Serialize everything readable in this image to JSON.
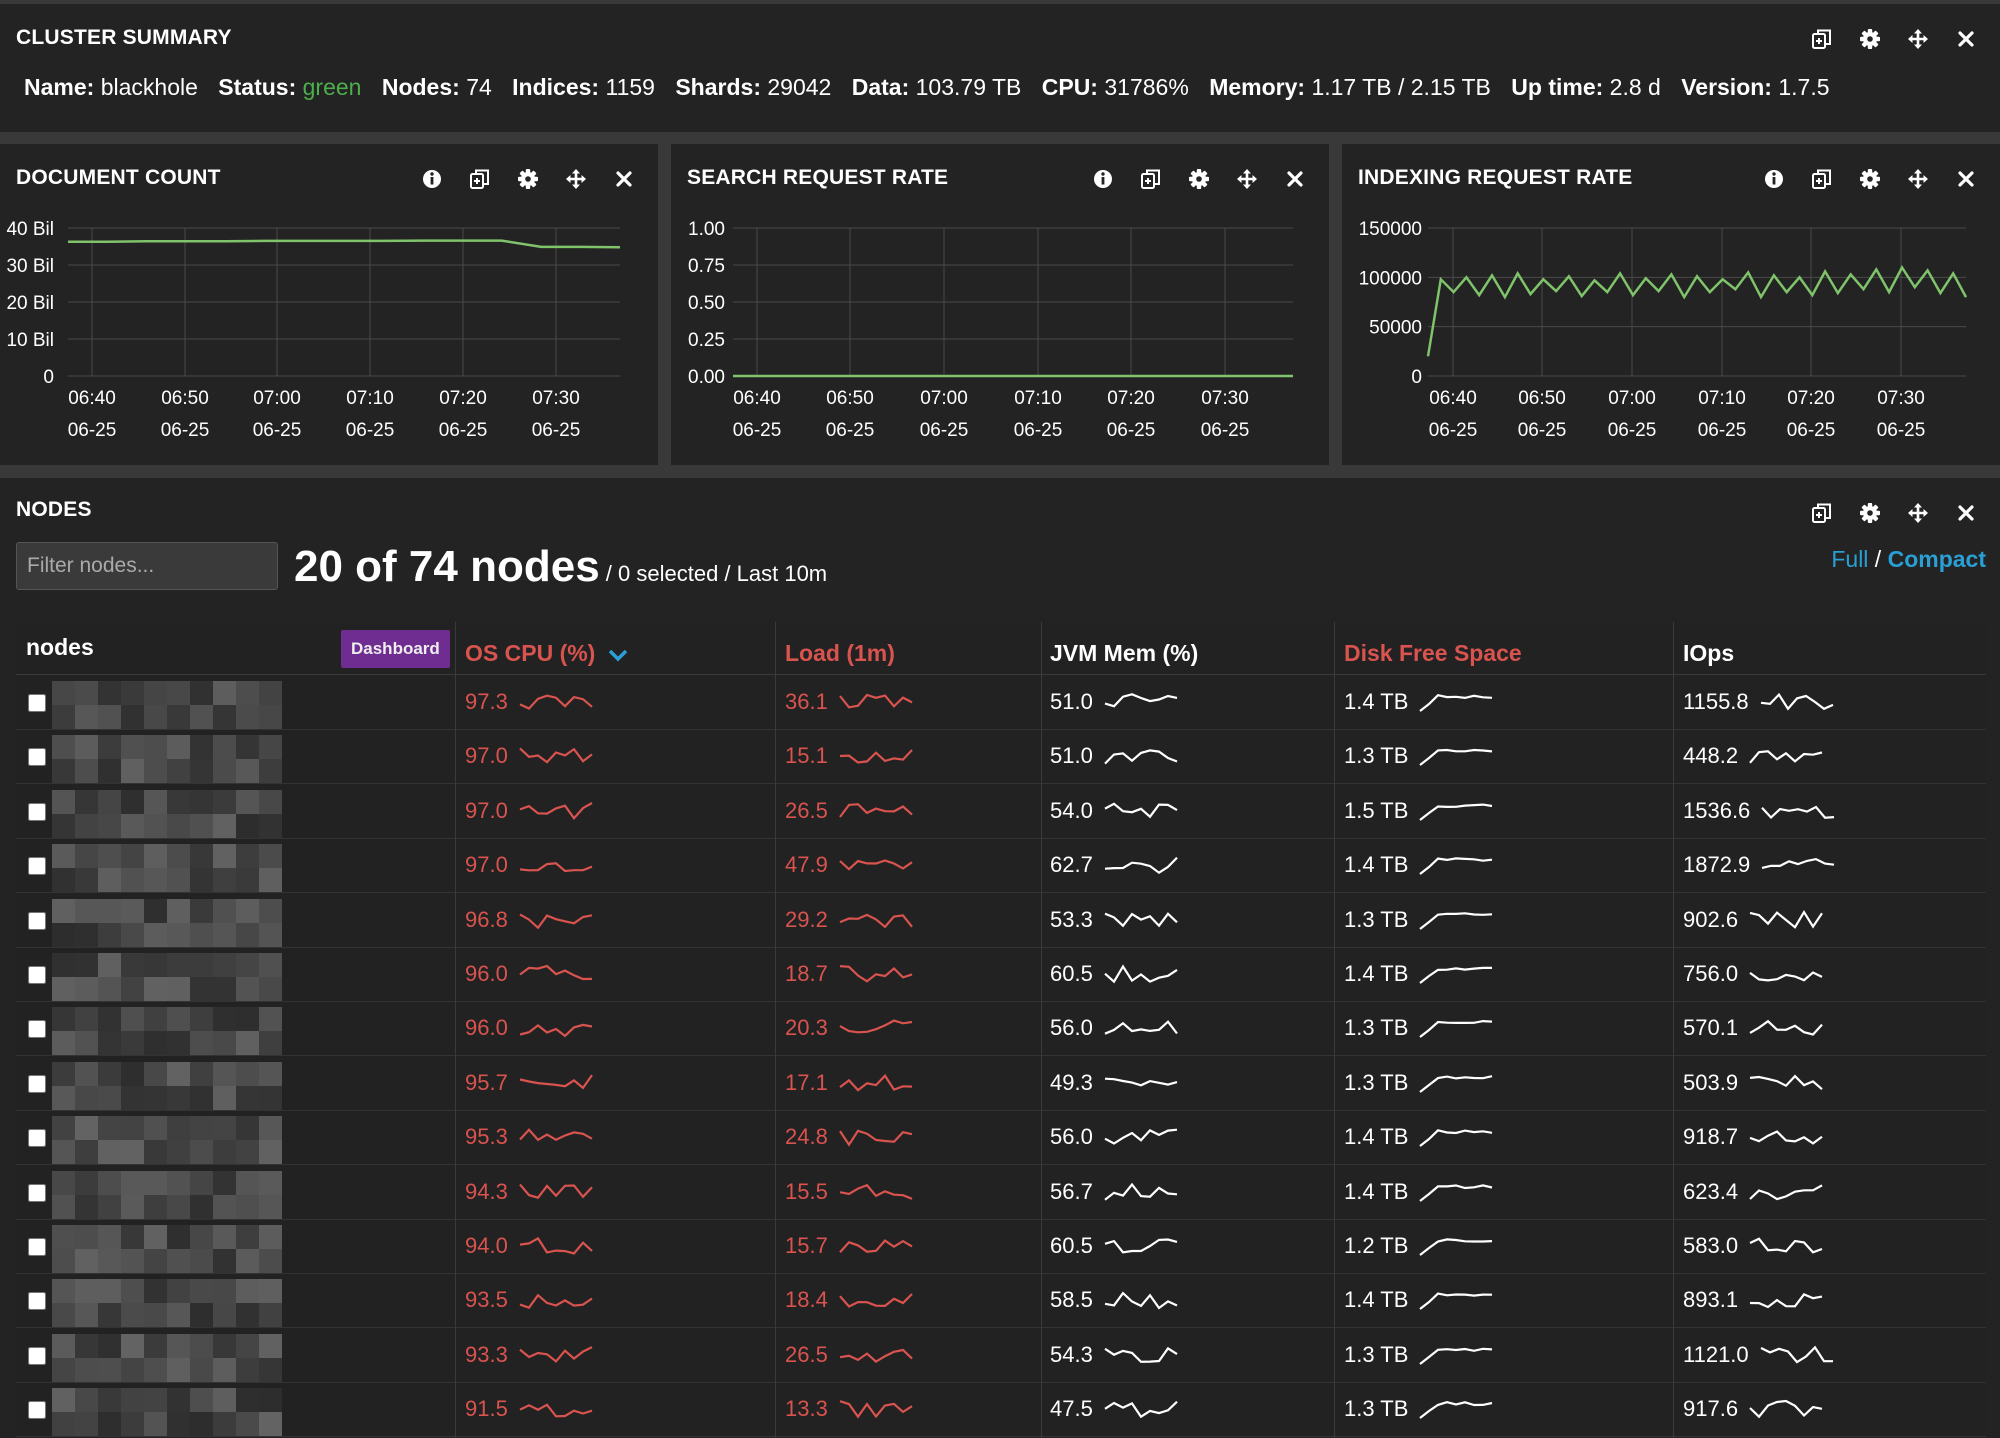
{
  "summary": {
    "title": "CLUSTER SUMMARY",
    "name_label": "Name:",
    "name": "blackhole",
    "status_label": "Status:",
    "status": "green",
    "nodes_label": "Nodes:",
    "nodes": "74",
    "indices_label": "Indices:",
    "indices": "1159",
    "shards_label": "Shards:",
    "shards": "29042",
    "data_label": "Data:",
    "data": "103.79 TB",
    "cpu_label": "CPU:",
    "cpu": "31786%",
    "memory_label": "Memory:",
    "memory": "1.17 TB / 2.15 TB",
    "uptime_label": "Up time:",
    "uptime": "2.8 d",
    "version_label": "Version:",
    "version": "1.7.5"
  },
  "colors": {
    "green_status": "#4cae4c",
    "line": "#7fc36a",
    "red": "#d9534f",
    "accent": "#2a9fd6",
    "dashboard": "#6f2c91"
  },
  "panel_tool_icons": [
    "info-icon",
    "duplicate-icon",
    "gear-icon",
    "move-icon",
    "close-icon"
  ],
  "chart_data": [
    {
      "type": "line",
      "title": "DOCUMENT COUNT",
      "x": [
        "06:40",
        "06:50",
        "07:00",
        "07:10",
        "07:20",
        "07:30"
      ],
      "x_sub": [
        "06-25",
        "06-25",
        "06-25",
        "06-25",
        "06-25",
        "06-25"
      ],
      "yticks": [
        "40 Bil",
        "30 Bil",
        "20 Bil",
        "10 Bil",
        "0"
      ],
      "ylim": [
        0,
        40
      ],
      "series": [
        {
          "values": [
            36.3,
            36.3,
            36.4,
            36.4,
            36.4,
            36.5,
            36.5,
            36.5,
            36.5,
            36.6,
            36.6,
            36.6,
            34.9,
            34.9,
            34.8
          ]
        }
      ]
    },
    {
      "type": "line",
      "title": "SEARCH REQUEST RATE",
      "x": [
        "06:40",
        "06:50",
        "07:00",
        "07:10",
        "07:20",
        "07:30"
      ],
      "x_sub": [
        "06-25",
        "06-25",
        "06-25",
        "06-25",
        "06-25",
        "06-25"
      ],
      "yticks": [
        "1.00",
        "0.75",
        "0.50",
        "0.25",
        "0.00"
      ],
      "ylim": [
        0,
        1
      ],
      "series": [
        {
          "values": [
            0,
            0,
            0,
            0,
            0,
            0,
            0,
            0,
            0,
            0,
            0,
            0
          ]
        }
      ]
    },
    {
      "type": "line",
      "title": "INDEXING REQUEST RATE",
      "x": [
        "06:40",
        "06:50",
        "07:00",
        "07:10",
        "07:20",
        "07:30"
      ],
      "x_sub": [
        "06-25",
        "06-25",
        "06-25",
        "06-25",
        "06-25",
        "06-25"
      ],
      "yticks": [
        "150000",
        "100000",
        "50000",
        "0"
      ],
      "ylim": [
        0,
        150000
      ],
      "series": [
        {
          "values": [
            20000,
            98000,
            85000,
            100000,
            82000,
            102000,
            80000,
            104000,
            83000,
            98000,
            86000,
            101000,
            81000,
            97000,
            85000,
            104000,
            82000,
            99000,
            86000,
            103000,
            80000,
            101000,
            85000,
            98000,
            88000,
            105000,
            80000,
            102000,
            85000,
            100000,
            82000,
            106000,
            84000,
            103000,
            88000,
            108000,
            85000,
            110000,
            90000,
            107000,
            84000,
            104000,
            80000
          ]
        }
      ]
    }
  ],
  "nodes": {
    "title": "NODES",
    "filter_placeholder": "Filter nodes...",
    "count_text": "20 of 74 nodes",
    "sub_text": " / 0 selected / Last 10m",
    "view_full": "Full",
    "view_sep": " / ",
    "view_compact": "Compact",
    "columns": {
      "nodes": "nodes",
      "dashboard": "Dashboard",
      "os_cpu": "OS CPU (%)",
      "load": "Load (1m)",
      "jvm_mem": "JVM Mem (%)",
      "disk": "Disk Free Space",
      "iops": "IOps"
    },
    "rows": [
      {
        "cpu": "97.3",
        "load": "36.1",
        "jvm": "51.0",
        "disk": "1.4 TB",
        "iops": "1155.8"
      },
      {
        "cpu": "97.0",
        "load": "15.1",
        "jvm": "51.0",
        "disk": "1.3 TB",
        "iops": "448.2"
      },
      {
        "cpu": "97.0",
        "load": "26.5",
        "jvm": "54.0",
        "disk": "1.5 TB",
        "iops": "1536.6"
      },
      {
        "cpu": "97.0",
        "load": "47.9",
        "jvm": "62.7",
        "disk": "1.4 TB",
        "iops": "1872.9"
      },
      {
        "cpu": "96.8",
        "load": "29.2",
        "jvm": "53.3",
        "disk": "1.3 TB",
        "iops": "902.6"
      },
      {
        "cpu": "96.0",
        "load": "18.7",
        "jvm": "60.5",
        "disk": "1.4 TB",
        "iops": "756.0"
      },
      {
        "cpu": "96.0",
        "load": "20.3",
        "jvm": "56.0",
        "disk": "1.3 TB",
        "iops": "570.1"
      },
      {
        "cpu": "95.7",
        "load": "17.1",
        "jvm": "49.3",
        "disk": "1.3 TB",
        "iops": "503.9"
      },
      {
        "cpu": "95.3",
        "load": "24.8",
        "jvm": "56.0",
        "disk": "1.4 TB",
        "iops": "918.7"
      },
      {
        "cpu": "94.3",
        "load": "15.5",
        "jvm": "56.7",
        "disk": "1.4 TB",
        "iops": "623.4"
      },
      {
        "cpu": "94.0",
        "load": "15.7",
        "jvm": "60.5",
        "disk": "1.2 TB",
        "iops": "583.0"
      },
      {
        "cpu": "93.5",
        "load": "18.4",
        "jvm": "58.5",
        "disk": "1.4 TB",
        "iops": "893.1"
      },
      {
        "cpu": "93.3",
        "load": "26.5",
        "jvm": "54.3",
        "disk": "1.3 TB",
        "iops": "1121.0"
      },
      {
        "cpu": "91.5",
        "load": "13.3",
        "jvm": "47.5",
        "disk": "1.3 TB",
        "iops": "917.6"
      }
    ]
  }
}
